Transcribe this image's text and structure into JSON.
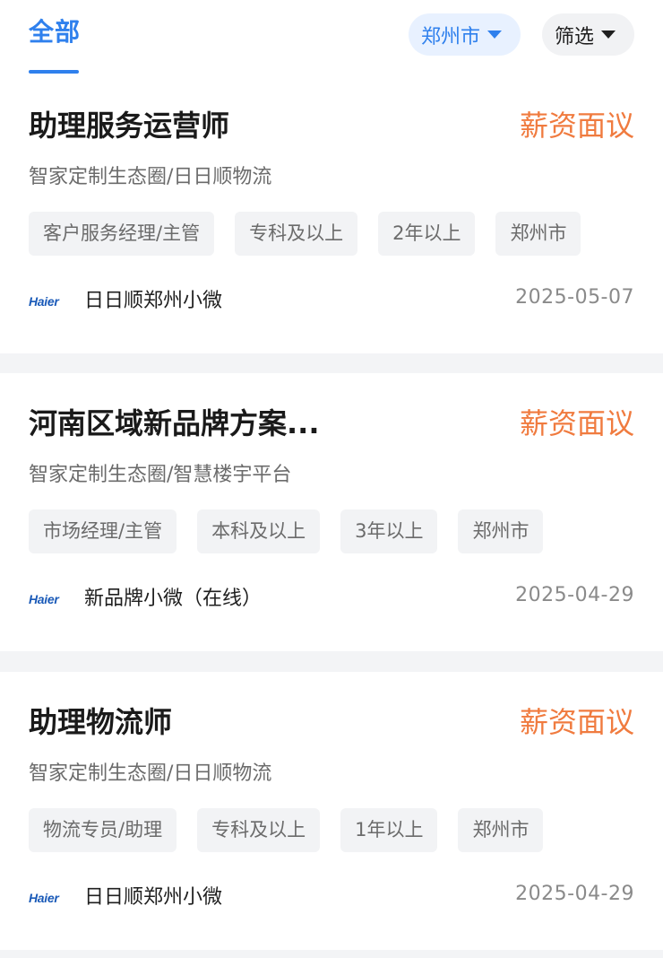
{
  "filters": {
    "tab_all": "全部",
    "city_label": "郑州市",
    "filter_label": "筛选"
  },
  "colors": {
    "accent": "#2f80ed",
    "salary": "#f07b3f",
    "tag_bg": "#f2f3f5"
  },
  "jobs": [
    {
      "title": "助理服务运营师",
      "salary": "薪资面议",
      "department": "智家定制生态圈/日日顺物流",
      "tags": [
        "客户服务经理/主管",
        "专科及以上",
        "2年以上",
        "郑州市"
      ],
      "company_logo": "Haier",
      "company": "日日顺郑州小微",
      "date": "2025-05-07"
    },
    {
      "title": "河南区域新品牌方案...",
      "salary": "薪资面议",
      "department": "智家定制生态圈/智慧楼宇平台",
      "tags": [
        "市场经理/主管",
        "本科及以上",
        "3年以上",
        "郑州市"
      ],
      "company_logo": "Haier",
      "company": "新品牌小微（在线）",
      "date": "2025-04-29"
    },
    {
      "title": "助理物流师",
      "salary": "薪资面议",
      "department": "智家定制生态圈/日日顺物流",
      "tags": [
        "物流专员/助理",
        "专科及以上",
        "1年以上",
        "郑州市"
      ],
      "company_logo": "Haier",
      "company": "日日顺郑州小微",
      "date": "2025-04-29"
    }
  ]
}
